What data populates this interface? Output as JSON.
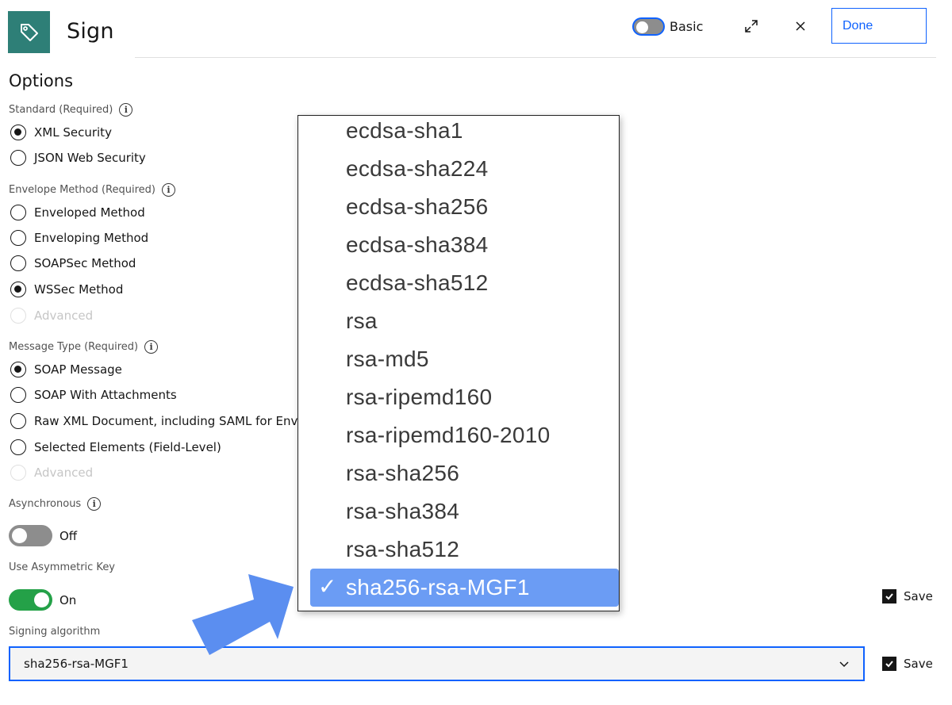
{
  "header": {
    "title": "Sign",
    "mode_label": "Basic",
    "done_label": "Done",
    "icon": "tag-icon"
  },
  "options": {
    "title": "Options",
    "standard": {
      "label": "Standard (Required)",
      "options": [
        "XML Security",
        "JSON Web Security"
      ],
      "selected": "XML Security"
    },
    "envelope": {
      "label": "Envelope Method (Required)",
      "options": [
        "Enveloped Method",
        "Enveloping Method",
        "SOAPSec Method",
        "WSSec Method",
        "Advanced"
      ],
      "selected": "WSSec Method"
    },
    "message_type": {
      "label": "Message Type (Required)",
      "options": [
        "SOAP Message",
        "SOAP With Attachments",
        "Raw XML Document, including SAML for Envelo",
        "Selected Elements (Field-Level)",
        "Advanced"
      ],
      "selected": "SOAP Message"
    },
    "asynchronous": {
      "label": "Asynchronous",
      "state": "Off"
    },
    "asymmetric": {
      "label": "Use Asymmetric Key",
      "state": "On"
    },
    "signing_algorithm": {
      "label": "Signing algorithm",
      "value": "sha256-rsa-MGF1"
    },
    "save_label": "Save"
  },
  "dropdown": {
    "items": [
      "ecdsa-sha1",
      "ecdsa-sha224",
      "ecdsa-sha256",
      "ecdsa-sha384",
      "ecdsa-sha512",
      "rsa",
      "rsa-md5",
      "rsa-ripemd160",
      "rsa-ripemd160-2010",
      "rsa-sha256",
      "rsa-sha384",
      "rsa-sha512"
    ],
    "selected": "sha256-rsa-MGF1",
    "check": "✓"
  },
  "colors": {
    "accent": "#0f62fe",
    "brand": "#2e7f77",
    "toggle_on": "#24a148",
    "highlight": "#6b9cf4",
    "annotation_arrow": "#5b8ef0"
  }
}
